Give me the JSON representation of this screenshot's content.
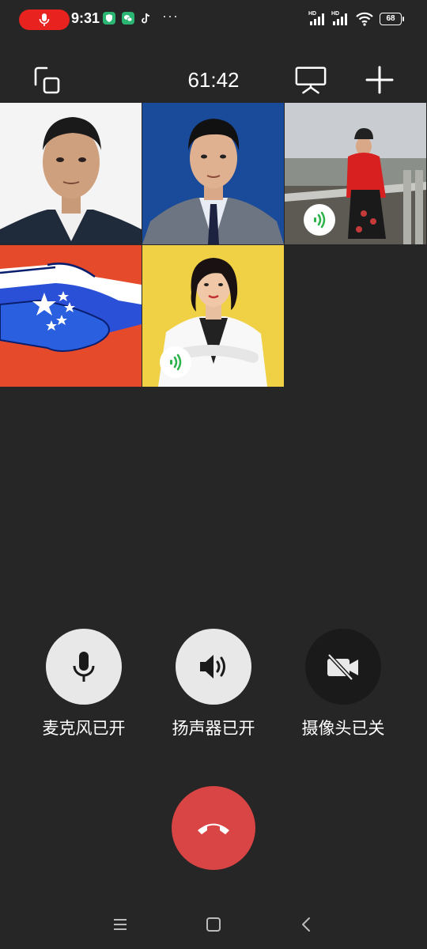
{
  "status_bar": {
    "time": "9:31",
    "more": "···",
    "hd1": "HD",
    "hd2": "HD",
    "battery": "68"
  },
  "call": {
    "timer": "61:42"
  },
  "controls": {
    "mic_label": "麦克风已开",
    "speaker_label": "扬声器已开",
    "camera_label": "摄像头已关"
  },
  "colors": {
    "background": "#262626",
    "hangup": "#d94444",
    "control_on": "#e8e8e8",
    "control_off": "#1a1a1a",
    "speaking": "#2bb34a"
  }
}
